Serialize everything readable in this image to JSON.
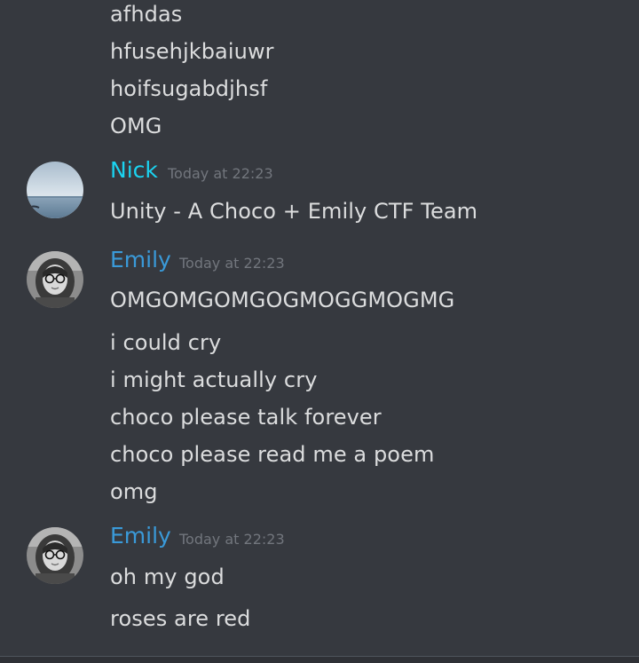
{
  "earlier_messages": [
    "afhdas",
    "hfusehjkbaiuwr",
    "hoifsugabdjhsf",
    "OMG"
  ],
  "groups": [
    {
      "author": "Nick",
      "author_color": "#1bd3f0",
      "timestamp": "Today at 22:23",
      "avatar_icon": "beach-photo-avatar",
      "messages": [
        "Unity - A Choco + Emily CTF Team"
      ]
    },
    {
      "author": "Emily",
      "author_color": "#3a9ad9",
      "timestamp": "Today at 22:23",
      "avatar_icon": "girl-with-glasses-avatar",
      "messages": [
        "OMGOMGOMGOGMOGGMOGMG",
        "i could cry",
        "i might actually cry",
        "choco please talk forever",
        "choco please read me a poem",
        "omg"
      ]
    },
    {
      "author": "Emily",
      "author_color": "#3a9ad9",
      "timestamp": "Today at 22:23",
      "avatar_icon": "girl-with-glasses-avatar",
      "messages": [
        "oh my god",
        "roses are red"
      ]
    }
  ]
}
